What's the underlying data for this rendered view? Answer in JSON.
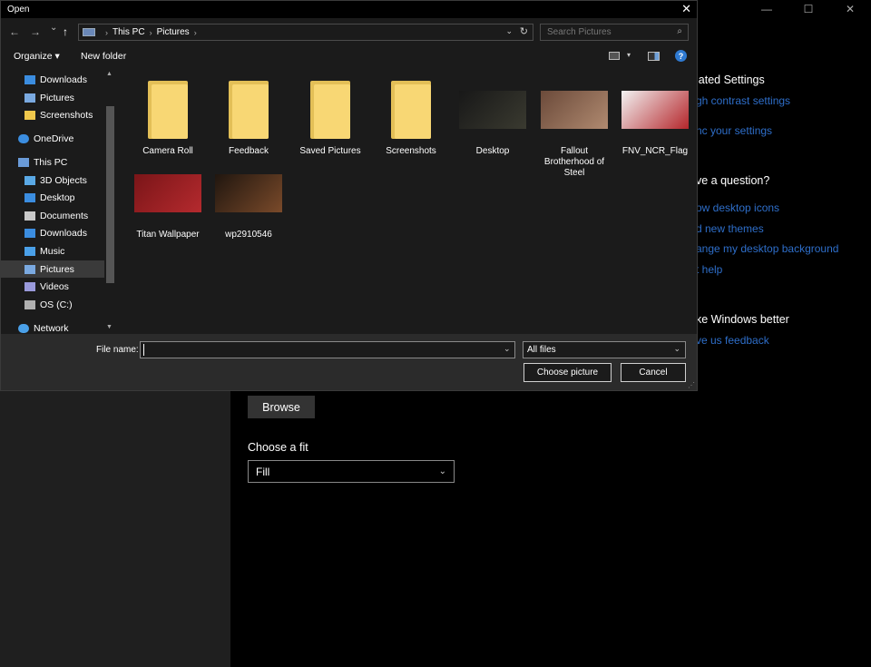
{
  "dialog": {
    "title": "Open",
    "close_glyph": "✕",
    "nav": {
      "back_glyph": "←",
      "forward_glyph": "→",
      "recent_glyph": "⌄",
      "up_glyph": "↑",
      "breadcrumb": [
        "This PC",
        "Pictures"
      ],
      "breadcrumb_sep": "›",
      "dropdown_glyph": "⌄",
      "refresh_glyph": "↻"
    },
    "search": {
      "placeholder": "Search Pictures",
      "icon_glyph": "⌕"
    },
    "toolbar": {
      "organize": "Organize ▾",
      "new_folder": "New folder",
      "view_dropdown": "▾",
      "help_glyph": "?"
    },
    "navpane": {
      "items": [
        {
          "label": "Downloads",
          "icon": "download-arrow-icon",
          "color": "#3b8de0",
          "indent": 1
        },
        {
          "label": "Pictures",
          "icon": "pictures-icon",
          "color": "#7aa9e0",
          "indent": 1
        },
        {
          "label": "Screenshots",
          "icon": "folder-icon",
          "color": "#f0c84c",
          "indent": 1
        },
        {
          "label": "OneDrive",
          "icon": "cloud-icon",
          "color": "#3b8de0",
          "indent": 0
        },
        {
          "label": "This PC",
          "icon": "computer-icon",
          "color": "#6a9bd8",
          "indent": 0
        },
        {
          "label": "3D Objects",
          "icon": "cube-icon",
          "color": "#5aa9e6",
          "indent": 1
        },
        {
          "label": "Desktop",
          "icon": "desktop-icon",
          "color": "#3b8de0",
          "indent": 1
        },
        {
          "label": "Documents",
          "icon": "document-icon",
          "color": "#c9c9c9",
          "indent": 1
        },
        {
          "label": "Downloads",
          "icon": "download-arrow-icon",
          "color": "#3b8de0",
          "indent": 1
        },
        {
          "label": "Music",
          "icon": "music-note-icon",
          "color": "#4aa0e8",
          "indent": 1
        },
        {
          "label": "Pictures",
          "icon": "pictures-icon",
          "color": "#7aa9e0",
          "indent": 1,
          "selected": true
        },
        {
          "label": "Videos",
          "icon": "video-icon",
          "color": "#9a9adb",
          "indent": 1
        },
        {
          "label": "OS (C:)",
          "icon": "drive-icon",
          "color": "#b0b0b0",
          "indent": 1
        },
        {
          "label": "Network",
          "icon": "network-icon",
          "color": "#4aa0e8",
          "indent": 0
        }
      ],
      "scroll_up_glyph": "▲",
      "scroll_down_glyph": "▼"
    },
    "files": [
      {
        "name": "Camera Roll",
        "kind": "folder"
      },
      {
        "name": "Feedback",
        "kind": "folder-docs"
      },
      {
        "name": "Saved Pictures",
        "kind": "folder-pdf"
      },
      {
        "name": "Screenshots",
        "kind": "folder"
      },
      {
        "name": "Desktop",
        "kind": "image",
        "colors": [
          "#181818",
          "#3a3a30"
        ]
      },
      {
        "name": "Fallout Brotherhood of Steel",
        "kind": "image",
        "colors": [
          "#6b4a3a",
          "#b08a70"
        ]
      },
      {
        "name": "FNV_NCR_Flag",
        "kind": "image",
        "colors": [
          "#f2f2f2",
          "#b5262b"
        ]
      },
      {
        "name": "Titan Wallpaper",
        "kind": "image",
        "colors": [
          "#7a1518",
          "#b52a2e"
        ]
      },
      {
        "name": "wp2910546",
        "kind": "image",
        "colors": [
          "#20160f",
          "#7a4a2a"
        ]
      }
    ],
    "footer": {
      "file_name_label": "File name:",
      "file_name_value": "",
      "dropdown_glyph": "⌄",
      "file_type": "All files",
      "choose_button": "Choose picture",
      "cancel_button": "Cancel",
      "grip_glyph": "⋰"
    }
  },
  "settings": {
    "window_controls": [
      "—",
      "☐",
      "✕"
    ],
    "related_heading": "lated Settings",
    "related_links": [
      "gh contrast settings",
      "nc your settings"
    ],
    "question_heading": "ve a question?",
    "question_links": [
      "ow desktop icons",
      "d new themes",
      "ange my desktop background",
      "t help"
    ],
    "better_heading": "ke Windows better",
    "better_links": [
      "ve us feedback"
    ],
    "browse_button": "Browse",
    "fit_label": "Choose a fit",
    "fit_value": "Fill",
    "fit_dropdown_glyph": "⌄"
  }
}
